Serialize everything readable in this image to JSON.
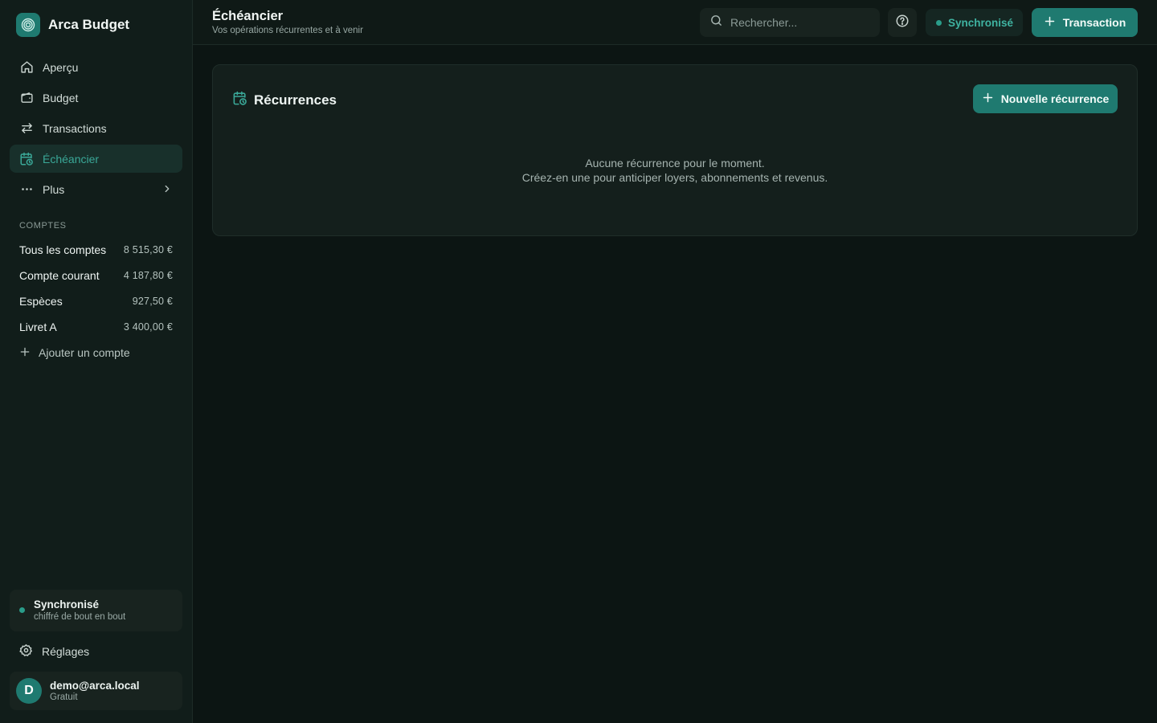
{
  "app": {
    "name": "Arca Budget"
  },
  "colors": {
    "accent": "#1f7a70",
    "accent_text": "#3aa898",
    "background": "#0c1513",
    "sidebar": "#111d1a"
  },
  "sidebar": {
    "nav": [
      {
        "label": "Aperçu",
        "icon": "home-icon"
      },
      {
        "label": "Budget",
        "icon": "wallet-icon"
      },
      {
        "label": "Transactions",
        "icon": "arrows-swap-icon"
      },
      {
        "label": "Échéancier",
        "icon": "calendar-clock-icon",
        "active": true
      },
      {
        "label": "Plus",
        "icon": "more-icon"
      }
    ],
    "accounts_label": "COMPTES",
    "accounts": [
      {
        "name": "Tous les comptes",
        "amount": "8 515,30 €"
      },
      {
        "name": "Compte courant",
        "amount": "4 187,80 €"
      },
      {
        "name": "Espèces",
        "amount": "927,50 €"
      },
      {
        "name": "Livret A",
        "amount": "3 400,00 €"
      }
    ],
    "add_account_label": "Ajouter un compte",
    "sync": {
      "title": "Synchronisé",
      "subtitle": "chiffré de bout en bout"
    },
    "settings_label": "Réglages",
    "user": {
      "initial": "D",
      "email": "demo@arca.local",
      "plan": "Gratuit"
    }
  },
  "header": {
    "title": "Échéancier",
    "subtitle": "Vos opérations récurrentes et à venir",
    "search_placeholder": "Rechercher...",
    "sync_label": "Synchronisé",
    "transaction_button": "Transaction"
  },
  "main": {
    "card_title": "Récurrences",
    "new_button": "Nouvelle récurrence",
    "empty_line1": "Aucune récurrence pour le moment.",
    "empty_line2": "Créez-en une pour anticiper loyers, abonnements et revenus."
  }
}
